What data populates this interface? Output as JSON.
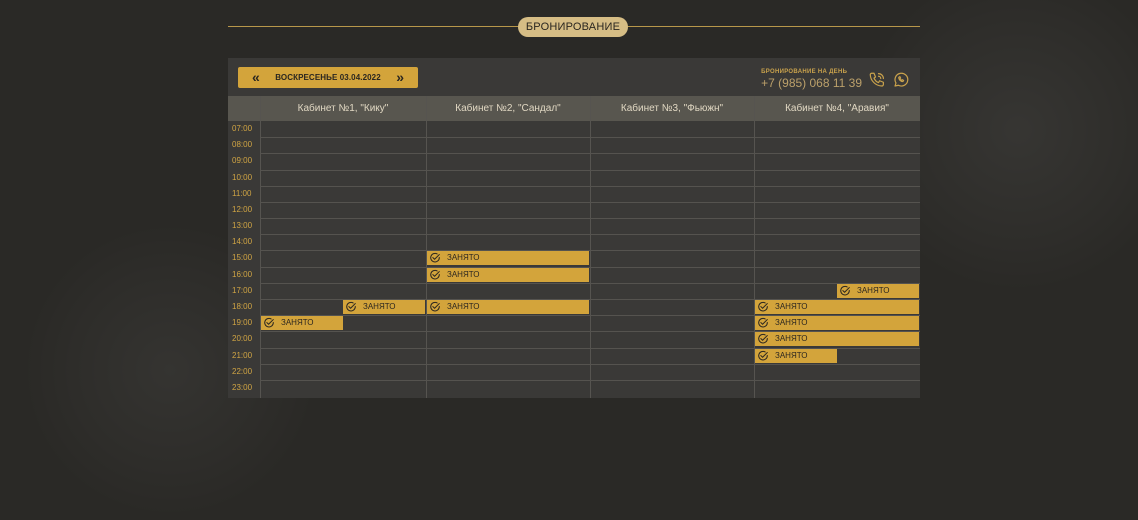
{
  "section_title": "БРОНИРОВАНИЕ",
  "date_nav": {
    "prev": "«",
    "label": "ВОСКРЕСЕНЬЕ 03.04.2022",
    "next": "»"
  },
  "contact": {
    "label": "БРОНИРОВАНИЕ НА ДЕНЬ",
    "phone": "+7 (985) 068 11 39",
    "icons": [
      "phone-icon",
      "whatsapp-icon"
    ]
  },
  "columns": [
    "Кабинет №1, \"Кику\"",
    "Кабинет №2, \"Сандал\"",
    "Кабинет №3, \"Фьюжн\"",
    "Кабинет №4, \"Аравия\""
  ],
  "times": [
    "07:00",
    "08:00",
    "09:00",
    "10:00",
    "11:00",
    "12:00",
    "13:00",
    "14:00",
    "15:00",
    "16:00",
    "17:00",
    "18:00",
    "19:00",
    "20:00",
    "21:00",
    "22:00",
    "23:00"
  ],
  "booked_label": "ЗАНЯТО",
  "bookings": [
    {
      "room": 1,
      "start": "18:00",
      "part": "right",
      "label": "ЗАНЯТО"
    },
    {
      "room": 1,
      "start": "19:00",
      "part": "left",
      "label": "ЗАНЯТО"
    },
    {
      "room": 2,
      "start": "15:00",
      "part": "full",
      "label": "ЗАНЯТО"
    },
    {
      "room": 2,
      "start": "16:00",
      "part": "full",
      "label": "ЗАНЯТО"
    },
    {
      "room": 2,
      "start": "18:00",
      "part": "full",
      "label": "ЗАНЯТО"
    },
    {
      "room": 4,
      "start": "17:00",
      "part": "right",
      "label": "ЗАНЯТО"
    },
    {
      "room": 4,
      "start": "18:00",
      "part": "full",
      "label": "ЗАНЯТО"
    },
    {
      "room": 4,
      "start": "19:00",
      "part": "full",
      "label": "ЗАНЯТО"
    },
    {
      "room": 4,
      "start": "20:00",
      "part": "full",
      "label": "ЗАНЯТО"
    },
    {
      "room": 4,
      "start": "21:00",
      "part": "left",
      "label": "ЗАНЯТО"
    }
  ],
  "colors": {
    "accent": "#d3a43b",
    "background": "#2a2926",
    "panel": "#3a3937",
    "header": "#58564f"
  }
}
